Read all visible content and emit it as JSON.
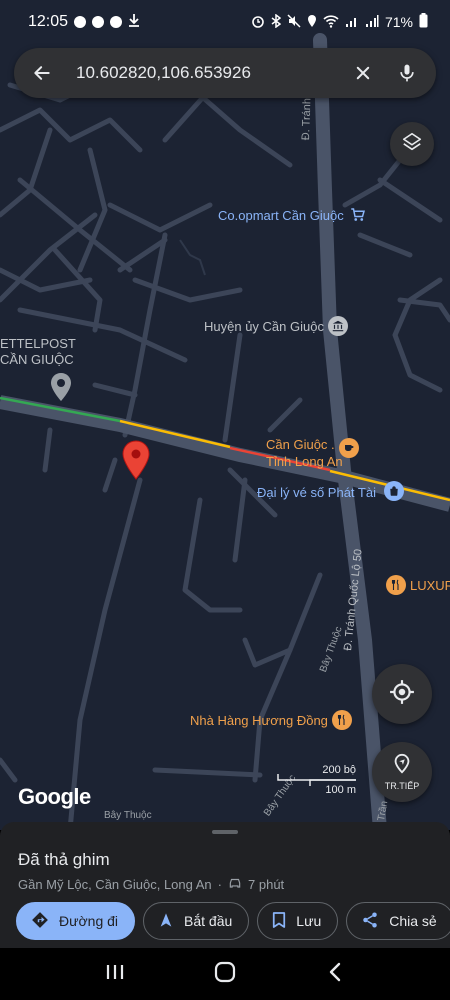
{
  "status_bar": {
    "time": "12:05",
    "battery": "71%"
  },
  "search": {
    "query": "10.602820,106.653926"
  },
  "map": {
    "places": {
      "coopmart": "Co.opmart Cần Giuộc",
      "huyen_uy": "Huyện ủy Cần Giuộc",
      "viettelpost_line1": "ETTELPOST",
      "viettelpost_line2": "CẦN GIUỘC",
      "can_giuoc_line1": "Cần Giuộc .",
      "can_giuoc_line2": "Tỉnh Long An",
      "dai_ly": "Đại lý vé số Phát Tài",
      "luxury": "LUXUR",
      "nha_hang": "Nhà Hàng Hương Đồng"
    },
    "roads": {
      "tranh_quoc_top": "Đ. Tránh Quốc",
      "tranh_quoc_lo": "Đ. Tránh Quốc Lộ 50",
      "bay_thuoc_1": "Bây Thuộc",
      "bay_thuoc_2": "Bây Thuộc",
      "bay_thuoc_3": "Bây Thuộc",
      "tran_bottom": "Trần"
    },
    "scale": {
      "top": "200 bộ",
      "bottom": "100 m"
    },
    "logo": "Google",
    "start_button_label": "TR.TIẾP"
  },
  "sheet": {
    "title": "Đã thả ghim",
    "location": "Gần Mỹ Lộc, Cần Giuộc, Long An",
    "travel_time": "7 phút",
    "actions": {
      "directions": "Đường đi",
      "start": "Bắt đầu",
      "save": "Lưu",
      "share": "Chia sẻ"
    }
  },
  "colors": {
    "map_bg": "#1c2333",
    "road": "#3c4558",
    "highway": "#4a5468",
    "accent_blue": "#8ab4f8",
    "pin_red": "#ea4335",
    "poi_orange": "#f0a04b"
  }
}
